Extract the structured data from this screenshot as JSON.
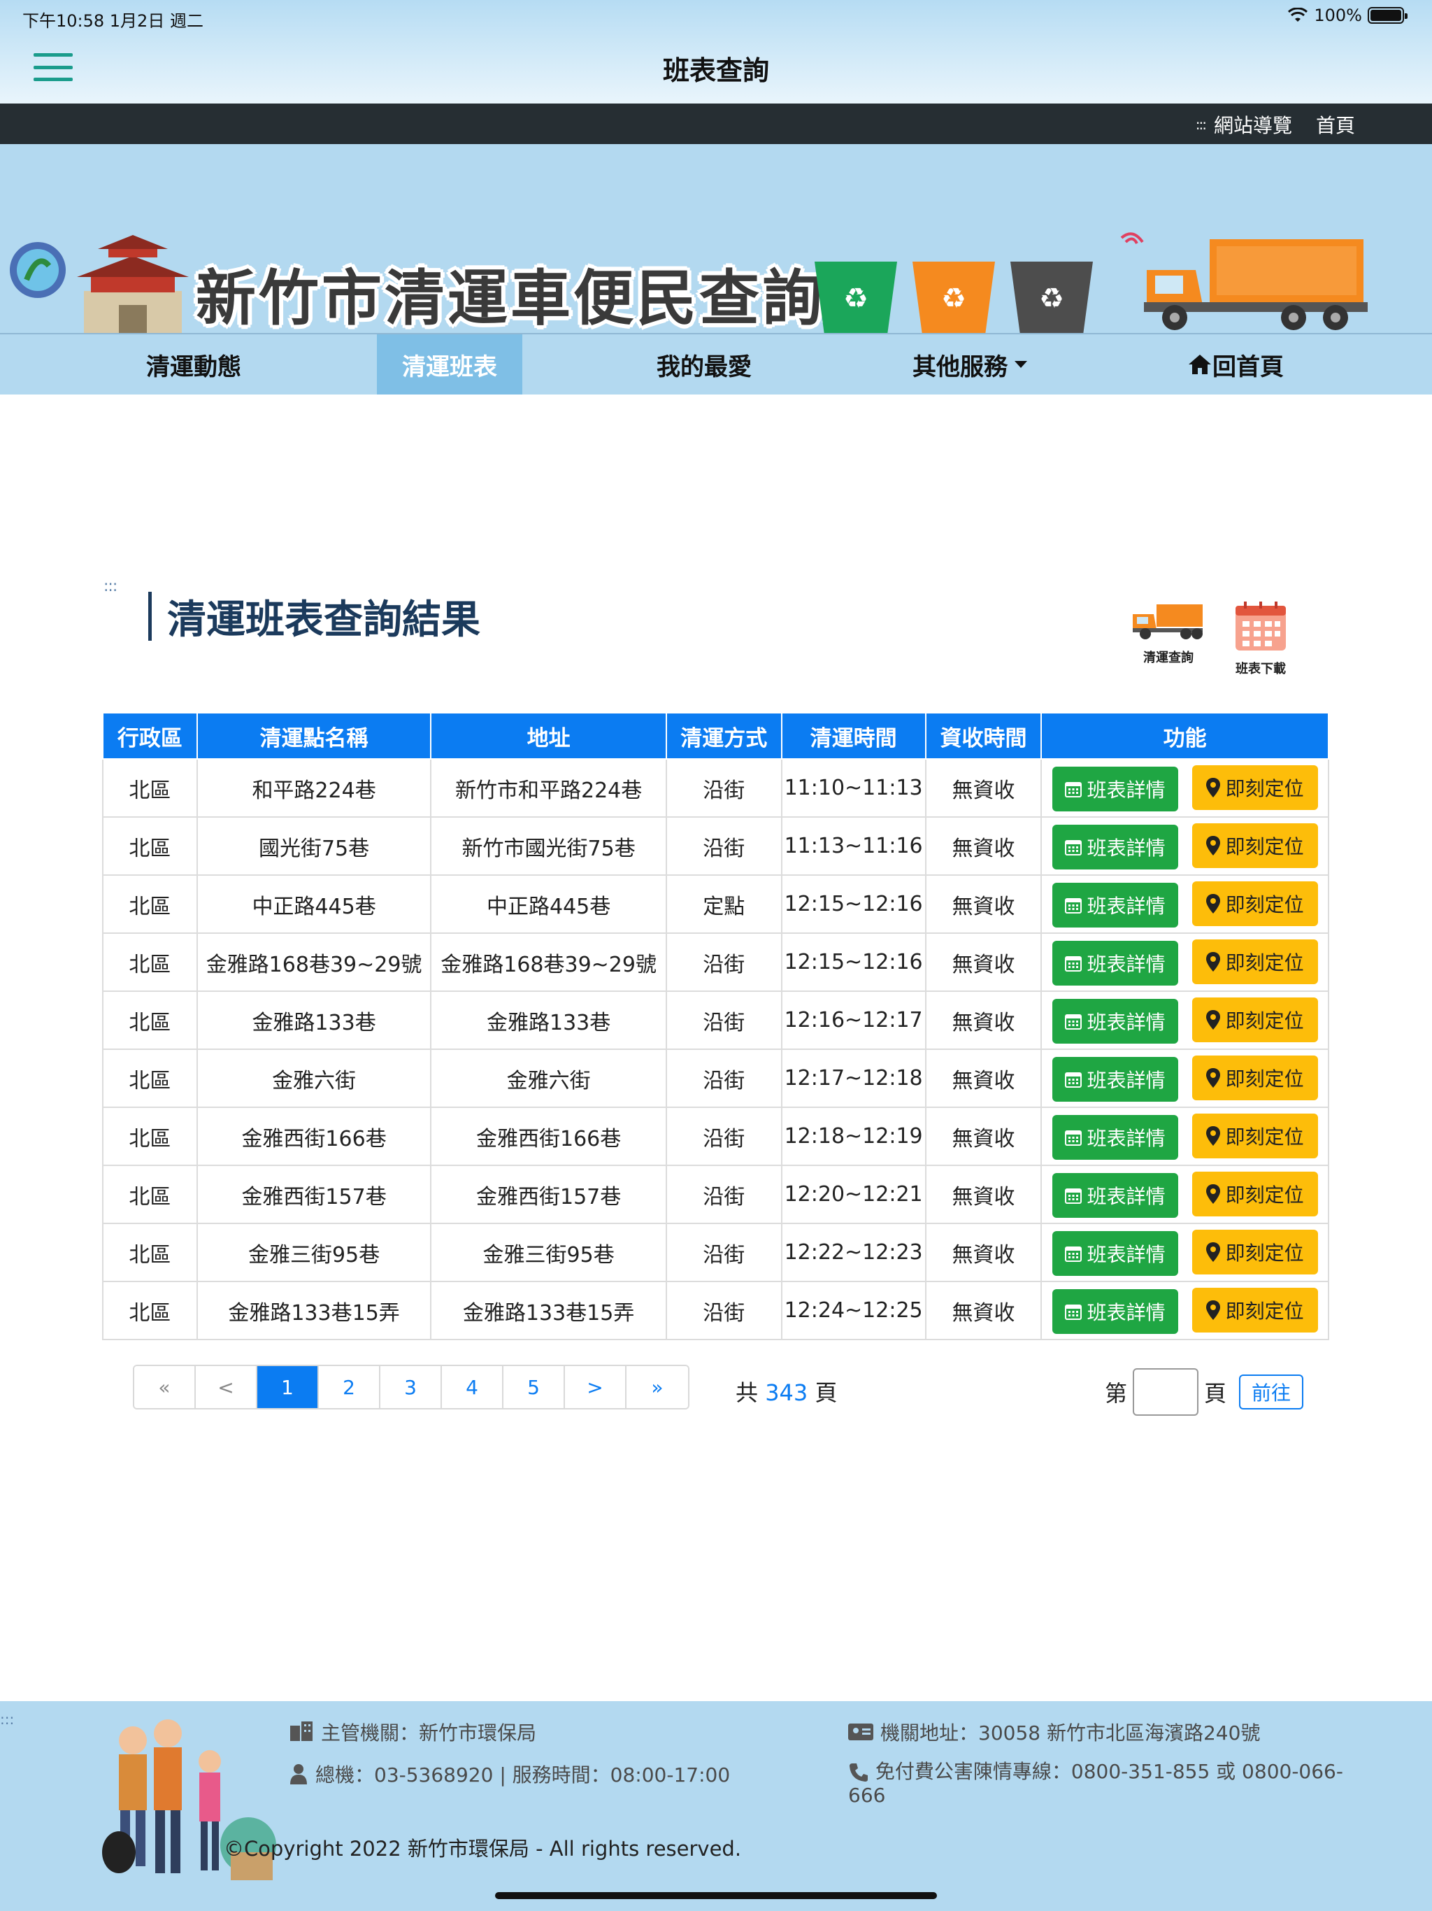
{
  "status_bar": {
    "time": "下午10:58   1月2日 週二",
    "battery": "100%"
  },
  "app_header": {
    "title": "班表查詢"
  },
  "top_bar": {
    "links": [
      "網站導覽",
      "首頁"
    ]
  },
  "banner": {
    "title": "新竹市清運車便民查詢網"
  },
  "nav": {
    "items": [
      "清運動態",
      "清運班表",
      "我的最愛",
      "其他服務",
      "回首頁"
    ]
  },
  "section": {
    "title": "清運班表查詢結果",
    "tools": [
      "清運查詢",
      "班表下載"
    ]
  },
  "table": {
    "headers": [
      "行政區",
      "清運點名稱",
      "地址",
      "清運方式",
      "清運時間",
      "資收時間",
      "功能"
    ],
    "detail_label": "班表詳情",
    "locate_label": "即刻定位",
    "rows": [
      [
        "北區",
        "和平路224巷",
        "新竹市和平路224巷",
        "沿街",
        "11:10~11:13",
        "無資收"
      ],
      [
        "北區",
        "國光街75巷",
        "新竹市國光街75巷",
        "沿街",
        "11:13~11:16",
        "無資收"
      ],
      [
        "北區",
        "中正路445巷",
        "中正路445巷",
        "定點",
        "12:15~12:16",
        "無資收"
      ],
      [
        "北區",
        "金雅路168巷39~29號",
        "金雅路168巷39~29號",
        "沿街",
        "12:15~12:16",
        "無資收"
      ],
      [
        "北區",
        "金雅路133巷",
        "金雅路133巷",
        "沿街",
        "12:16~12:17",
        "無資收"
      ],
      [
        "北區",
        "金雅六街",
        "金雅六街",
        "沿街",
        "12:17~12:18",
        "無資收"
      ],
      [
        "北區",
        "金雅西街166巷",
        "金雅西街166巷",
        "沿街",
        "12:18~12:19",
        "無資收"
      ],
      [
        "北區",
        "金雅西街157巷",
        "金雅西街157巷",
        "沿街",
        "12:20~12:21",
        "無資收"
      ],
      [
        "北區",
        "金雅三街95巷",
        "金雅三街95巷",
        "沿街",
        "12:22~12:23",
        "無資收"
      ],
      [
        "北區",
        "金雅路133巷15弄",
        "金雅路133巷15弄",
        "沿街",
        "12:24~12:25",
        "無資收"
      ]
    ]
  },
  "pagination": {
    "items": [
      "«",
      "<",
      "1",
      "2",
      "3",
      "4",
      "5",
      ">",
      "»"
    ],
    "current": "1",
    "total_prefix": "共",
    "total_pages": "343",
    "total_suffix": "頁",
    "goto_prefix": "第",
    "goto_suffix": "頁",
    "goto_button": "前往",
    "goto_value": ""
  },
  "footer": {
    "agency": "主管機關：新竹市環保局",
    "phone": "總機：03-5368920 | 服務時間：08:00-17:00",
    "address": "機關地址：30058 新竹市北區海濱路240號",
    "hotline": "免付費公害陳情專線：0800-351-855 或 0800-066-666",
    "copyright": "©Copyright 2022 新竹市環保局 - All rights reserved."
  },
  "colors": {
    "header_blue": "#0b7cf2",
    "detail_green": "#1fa643",
    "locate_yellow": "#fdbd0a",
    "banner_bg": "#b3d9f0",
    "top_bar_dark": "#262e33"
  }
}
